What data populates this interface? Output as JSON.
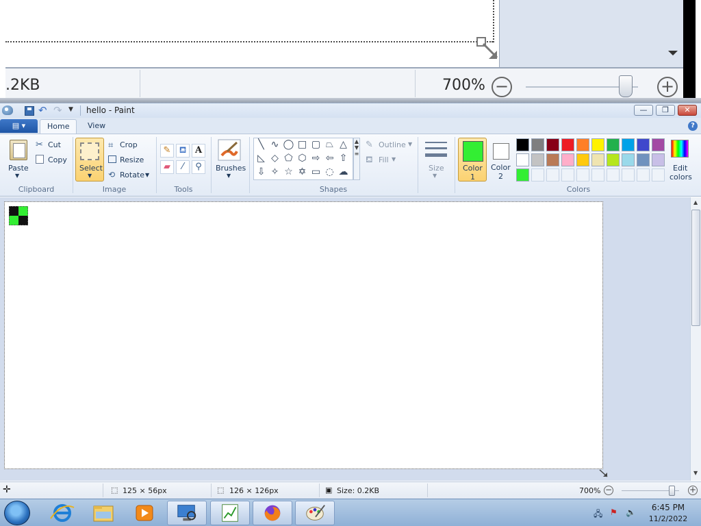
{
  "zoom_strip": {
    "size_text": ".2KB",
    "zoom_text": "700%"
  },
  "window": {
    "title": "hello - Paint",
    "min_glyph": "—",
    "max_glyph": "❐",
    "close_glyph": "✕"
  },
  "tabs": {
    "file": "▤ ▾",
    "home": "Home",
    "view": "View",
    "help": "?"
  },
  "ribbon": {
    "clipboard": {
      "group": "Clipboard",
      "paste": "Paste",
      "cut": "Cut",
      "copy": "Copy"
    },
    "image": {
      "group": "Image",
      "select": "Select",
      "crop": "Crop",
      "resize": "Resize",
      "rotate": "Rotate"
    },
    "tools": {
      "group": "Tools"
    },
    "brushes": {
      "label": "Brushes"
    },
    "shapes": {
      "group": "Shapes",
      "outline": "Outline",
      "fill": "Fill"
    },
    "size": {
      "label": "Size"
    },
    "colors": {
      "group": "Colors",
      "color1_label": "Color",
      "color1_num": "1",
      "color2_label": "Color",
      "color2_num": "2",
      "color1": "#33ee33",
      "color2": "#ffffff",
      "edit_label": "Edit",
      "edit_label2": "colors",
      "palette_row1": [
        "#000000",
        "#7f7f7f",
        "#880015",
        "#ed1c24",
        "#ff7f27",
        "#fff200",
        "#22b14c",
        "#00a2e8",
        "#3f48cc",
        "#a349a4"
      ],
      "palette_row2": [
        "#ffffff",
        "#c3c3c3",
        "#b97a57",
        "#ffaec9",
        "#ffc90e",
        "#efe4b0",
        "#b5e61d",
        "#99d9ea",
        "#7092be",
        "#c8bfe7"
      ],
      "palette_row3": [
        "#33ee33"
      ]
    }
  },
  "status": {
    "selection_size": "125 × 56px",
    "canvas_size": "126 × 126px",
    "file_size": "Size: 0.2KB",
    "zoom": "700%"
  },
  "taskbar": {
    "time": "6:45 PM",
    "date": "11/2/2022"
  }
}
